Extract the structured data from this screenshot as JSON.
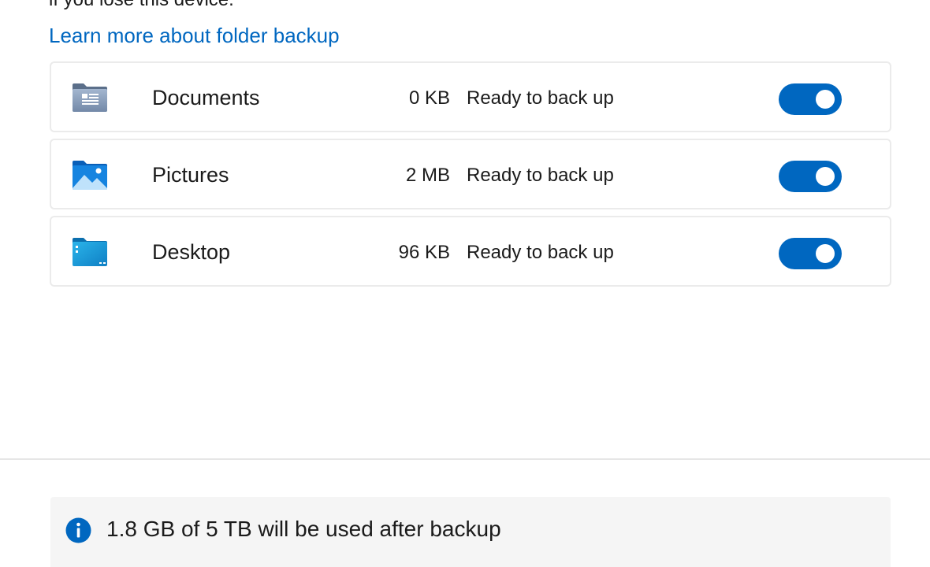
{
  "intro": {
    "partial_text": "if you lose this device.",
    "learn_more_link": "Learn more about folder backup"
  },
  "folders": [
    {
      "name": "Documents",
      "size": "0 KB",
      "status": "Ready to back up",
      "icon": "documents-folder-icon",
      "backup_enabled": true
    },
    {
      "name": "Pictures",
      "size": "2 MB",
      "status": "Ready to back up",
      "icon": "pictures-folder-icon",
      "backup_enabled": true
    },
    {
      "name": "Desktop",
      "size": "96 KB",
      "status": "Ready to back up",
      "icon": "desktop-folder-icon",
      "backup_enabled": true
    }
  ],
  "footer": {
    "info_text": "1.8 GB of 5 TB will be used after backup",
    "info_icon": "info-icon"
  },
  "colors": {
    "accent": "#0067c0",
    "link": "#0067c0",
    "info_bar_bg": "#f5f5f5"
  }
}
